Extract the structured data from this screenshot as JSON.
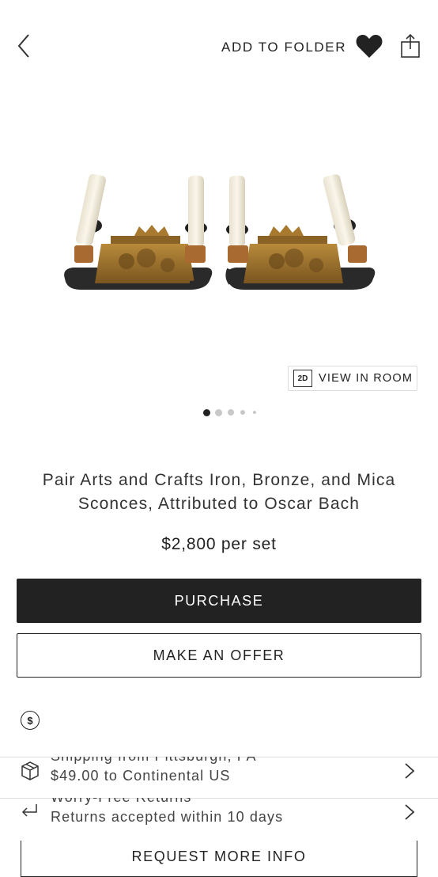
{
  "header": {
    "add_to_folder_label": "ADD TO FOLDER",
    "back_icon": "chevron-left-icon",
    "favorite_icon": "heart-icon",
    "share_icon": "share-icon"
  },
  "gallery": {
    "view_in_room_badge": "2D",
    "view_in_room_label": "VIEW IN ROOM",
    "dot_count": 5,
    "active_dot": 0
  },
  "product": {
    "title": "Pair Arts and Crafts Iron, Bronze, and Mica Sconces, Attributed to Oscar Bach",
    "price": "$2,800 per set"
  },
  "actions": {
    "purchase_label": "PURCHASE",
    "offer_label": "MAKE AN OFFER",
    "request_info_label": "REQUEST MORE INFO"
  },
  "info": {
    "price_icon": "dollar-icon",
    "shipping": {
      "title": "Shipping from Pittsburgh, PA",
      "detail": "$49.00 to Continental US",
      "icon": "box-icon"
    },
    "returns": {
      "title": "Worry-Free Returns",
      "detail": "Returns accepted within 10 days",
      "icon": "return-arrow-icon"
    }
  },
  "colors": {
    "primary_button": "#222222",
    "border": "#dedede",
    "bronze": "#9a6a2a"
  }
}
